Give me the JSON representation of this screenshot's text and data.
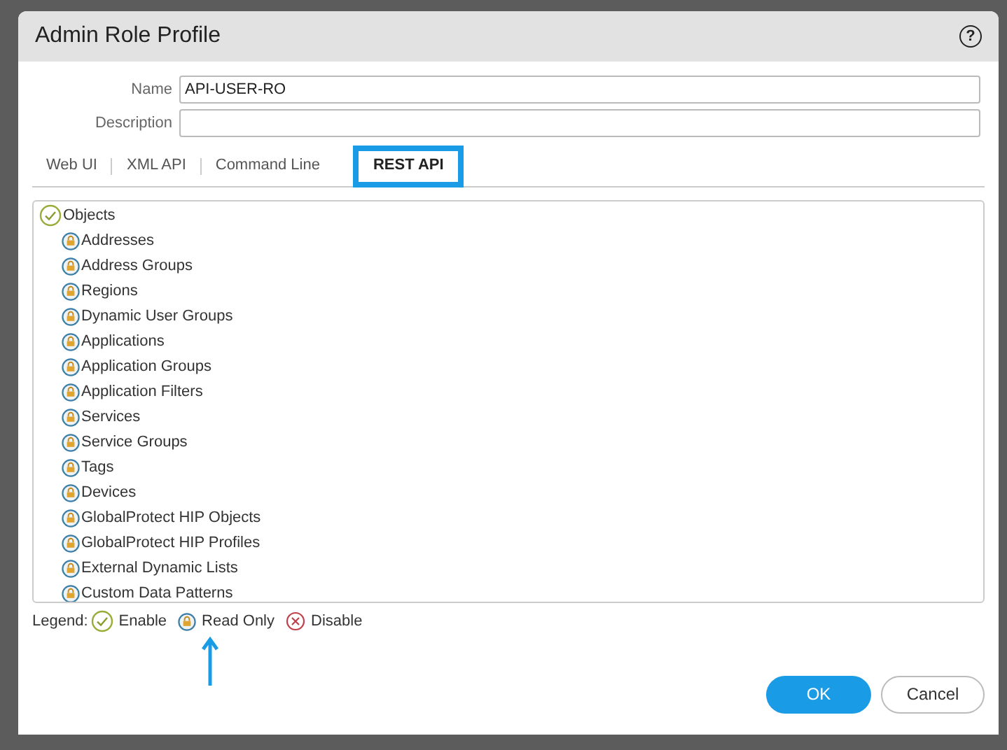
{
  "window": {
    "title": "Admin Role Profile",
    "help": "?"
  },
  "fields": [
    {
      "label": "Name",
      "value": "API-USER-RO"
    },
    {
      "label": "Description"
    }
  ],
  "tabs": [
    {
      "label": "Web UI",
      "selected": false
    },
    {
      "label": "XML API",
      "selected": false
    },
    {
      "label": "Command Line",
      "selected": false
    },
    {
      "label": "REST API",
      "selected": true
    }
  ],
  "tree": [
    {
      "label": "Objects",
      "kind": "enable",
      "children": [
        {
          "label": "Addresses",
          "kind": "read_only"
        },
        {
          "label": "Address Groups",
          "kind": "read_only"
        },
        {
          "label": "Regions",
          "kind": "read_only"
        },
        {
          "label": "Dynamic User Groups",
          "kind": "read_only"
        },
        {
          "label": "Applications",
          "kind": "read_only"
        },
        {
          "label": "Application Groups",
          "kind": "read_only"
        },
        {
          "label": "Application Filters",
          "kind": "read_only"
        },
        {
          "label": "Services",
          "kind": "read_only"
        },
        {
          "label": "Service Groups",
          "kind": "read_only"
        },
        {
          "label": "Tags",
          "kind": "read_only"
        },
        {
          "label": "Devices",
          "kind": "read_only"
        },
        {
          "label": "GlobalProtect HIP Objects",
          "kind": "read_only"
        },
        {
          "label": "GlobalProtect HIP Profiles",
          "kind": "read_only"
        },
        {
          "label": "External Dynamic Lists",
          "kind": "read_only"
        },
        {
          "label": "Custom Data Patterns",
          "kind": "read_only"
        }
      ]
    }
  ],
  "legend": {
    "title": "Legend:",
    "items": [
      {
        "kind": "enable",
        "label": "Enable"
      },
      {
        "kind": "read_only",
        "label": "Read Only"
      },
      {
        "kind": "disable",
        "label": "Disable"
      }
    ]
  },
  "buttons": [
    {
      "label": "OK",
      "kind": "primary"
    },
    {
      "label": "Cancel",
      "kind": "secondary"
    }
  ]
}
